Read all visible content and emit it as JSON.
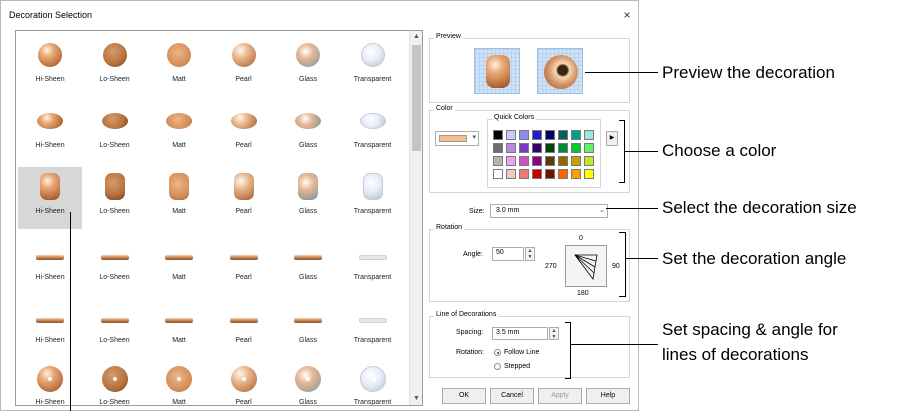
{
  "dialog": {
    "title": "Decoration Selection",
    "close_glyph": "×"
  },
  "gallery": {
    "rows": [
      {
        "shape": "round",
        "items": [
          "Hi-Sheen",
          "Lo-Sheen",
          "Matt",
          "Pearl",
          "Glass",
          "Transparent"
        ]
      },
      {
        "shape": "flat",
        "items": [
          "Hi-Sheen",
          "Lo-Sheen",
          "Matt",
          "Pearl",
          "Glass",
          "Transparent"
        ]
      },
      {
        "shape": "cyl",
        "items": [
          "Hi-Sheen",
          "Lo-Sheen",
          "Matt",
          "Pearl",
          "Glass",
          "Transparent"
        ]
      },
      {
        "shape": "bugle",
        "items": [
          "Hi-Sheen",
          "Lo-Sheen",
          "Matt",
          "Pearl",
          "Glass",
          "Transparent"
        ]
      },
      {
        "shape": "bugle",
        "items": [
          "Hi-Sheen",
          "Lo-Sheen",
          "Matt",
          "Pearl",
          "Glass",
          "Transparent"
        ]
      },
      {
        "shape": "seq",
        "items": [
          "Hi-Sheen",
          "Lo-Sheen",
          "Matt",
          "Pearl",
          "Glass",
          "Transparent"
        ]
      }
    ],
    "selected": {
      "row": 2,
      "col": 0
    }
  },
  "preview": {
    "label": "Preview"
  },
  "color": {
    "label": "Color",
    "current": "#f7bd88",
    "quick_label": "Quick Colors",
    "quick_colors": [
      [
        "#000000",
        "#c8c8ff",
        "#8c8cf0",
        "#1c1cc8",
        "#00006e",
        "#006464",
        "#00a08c",
        "#a0e6dc"
      ],
      [
        "#6e6e6e",
        "#b48ce6",
        "#7838c8",
        "#3c006e",
        "#00460a",
        "#008c3c",
        "#00c832",
        "#64f064"
      ],
      [
        "#b4b4b4",
        "#f0a0f0",
        "#c850c8",
        "#8c008c",
        "#5a3c00",
        "#966400",
        "#c8a000",
        "#c8e628"
      ],
      [
        "#ffffff",
        "#f0c8c8",
        "#f07878",
        "#c80000",
        "#6e1400",
        "#ff6400",
        "#ffa000",
        "#ffff00"
      ]
    ],
    "more_glyph": "▶"
  },
  "size": {
    "label": "Size:",
    "value": "3.0 mm"
  },
  "rotation": {
    "label": "Rotation",
    "angle_label": "Angle:",
    "angle_value": "50",
    "angle_deg": 50,
    "dial": {
      "top": "0",
      "right": "90",
      "bottom": "180",
      "left": "270"
    }
  },
  "line_of_decorations": {
    "label": "Line of Decorations",
    "spacing_label": "Spacing:",
    "spacing_value": "3.5 mm",
    "rotation_label": "Rotation:",
    "options": [
      "Follow Line",
      "Stepped"
    ],
    "selected": 0
  },
  "buttons": {
    "ok": "OK",
    "cancel": "Cancel",
    "apply": "Apply",
    "help": "Help"
  },
  "annotations": {
    "preview": "Preview the decoration",
    "color": "Choose a color",
    "size": "Select the decoration size",
    "angle": "Set the decoration angle",
    "lines_1": "Set spacing & angle for",
    "lines_2": "lines of decorations"
  }
}
